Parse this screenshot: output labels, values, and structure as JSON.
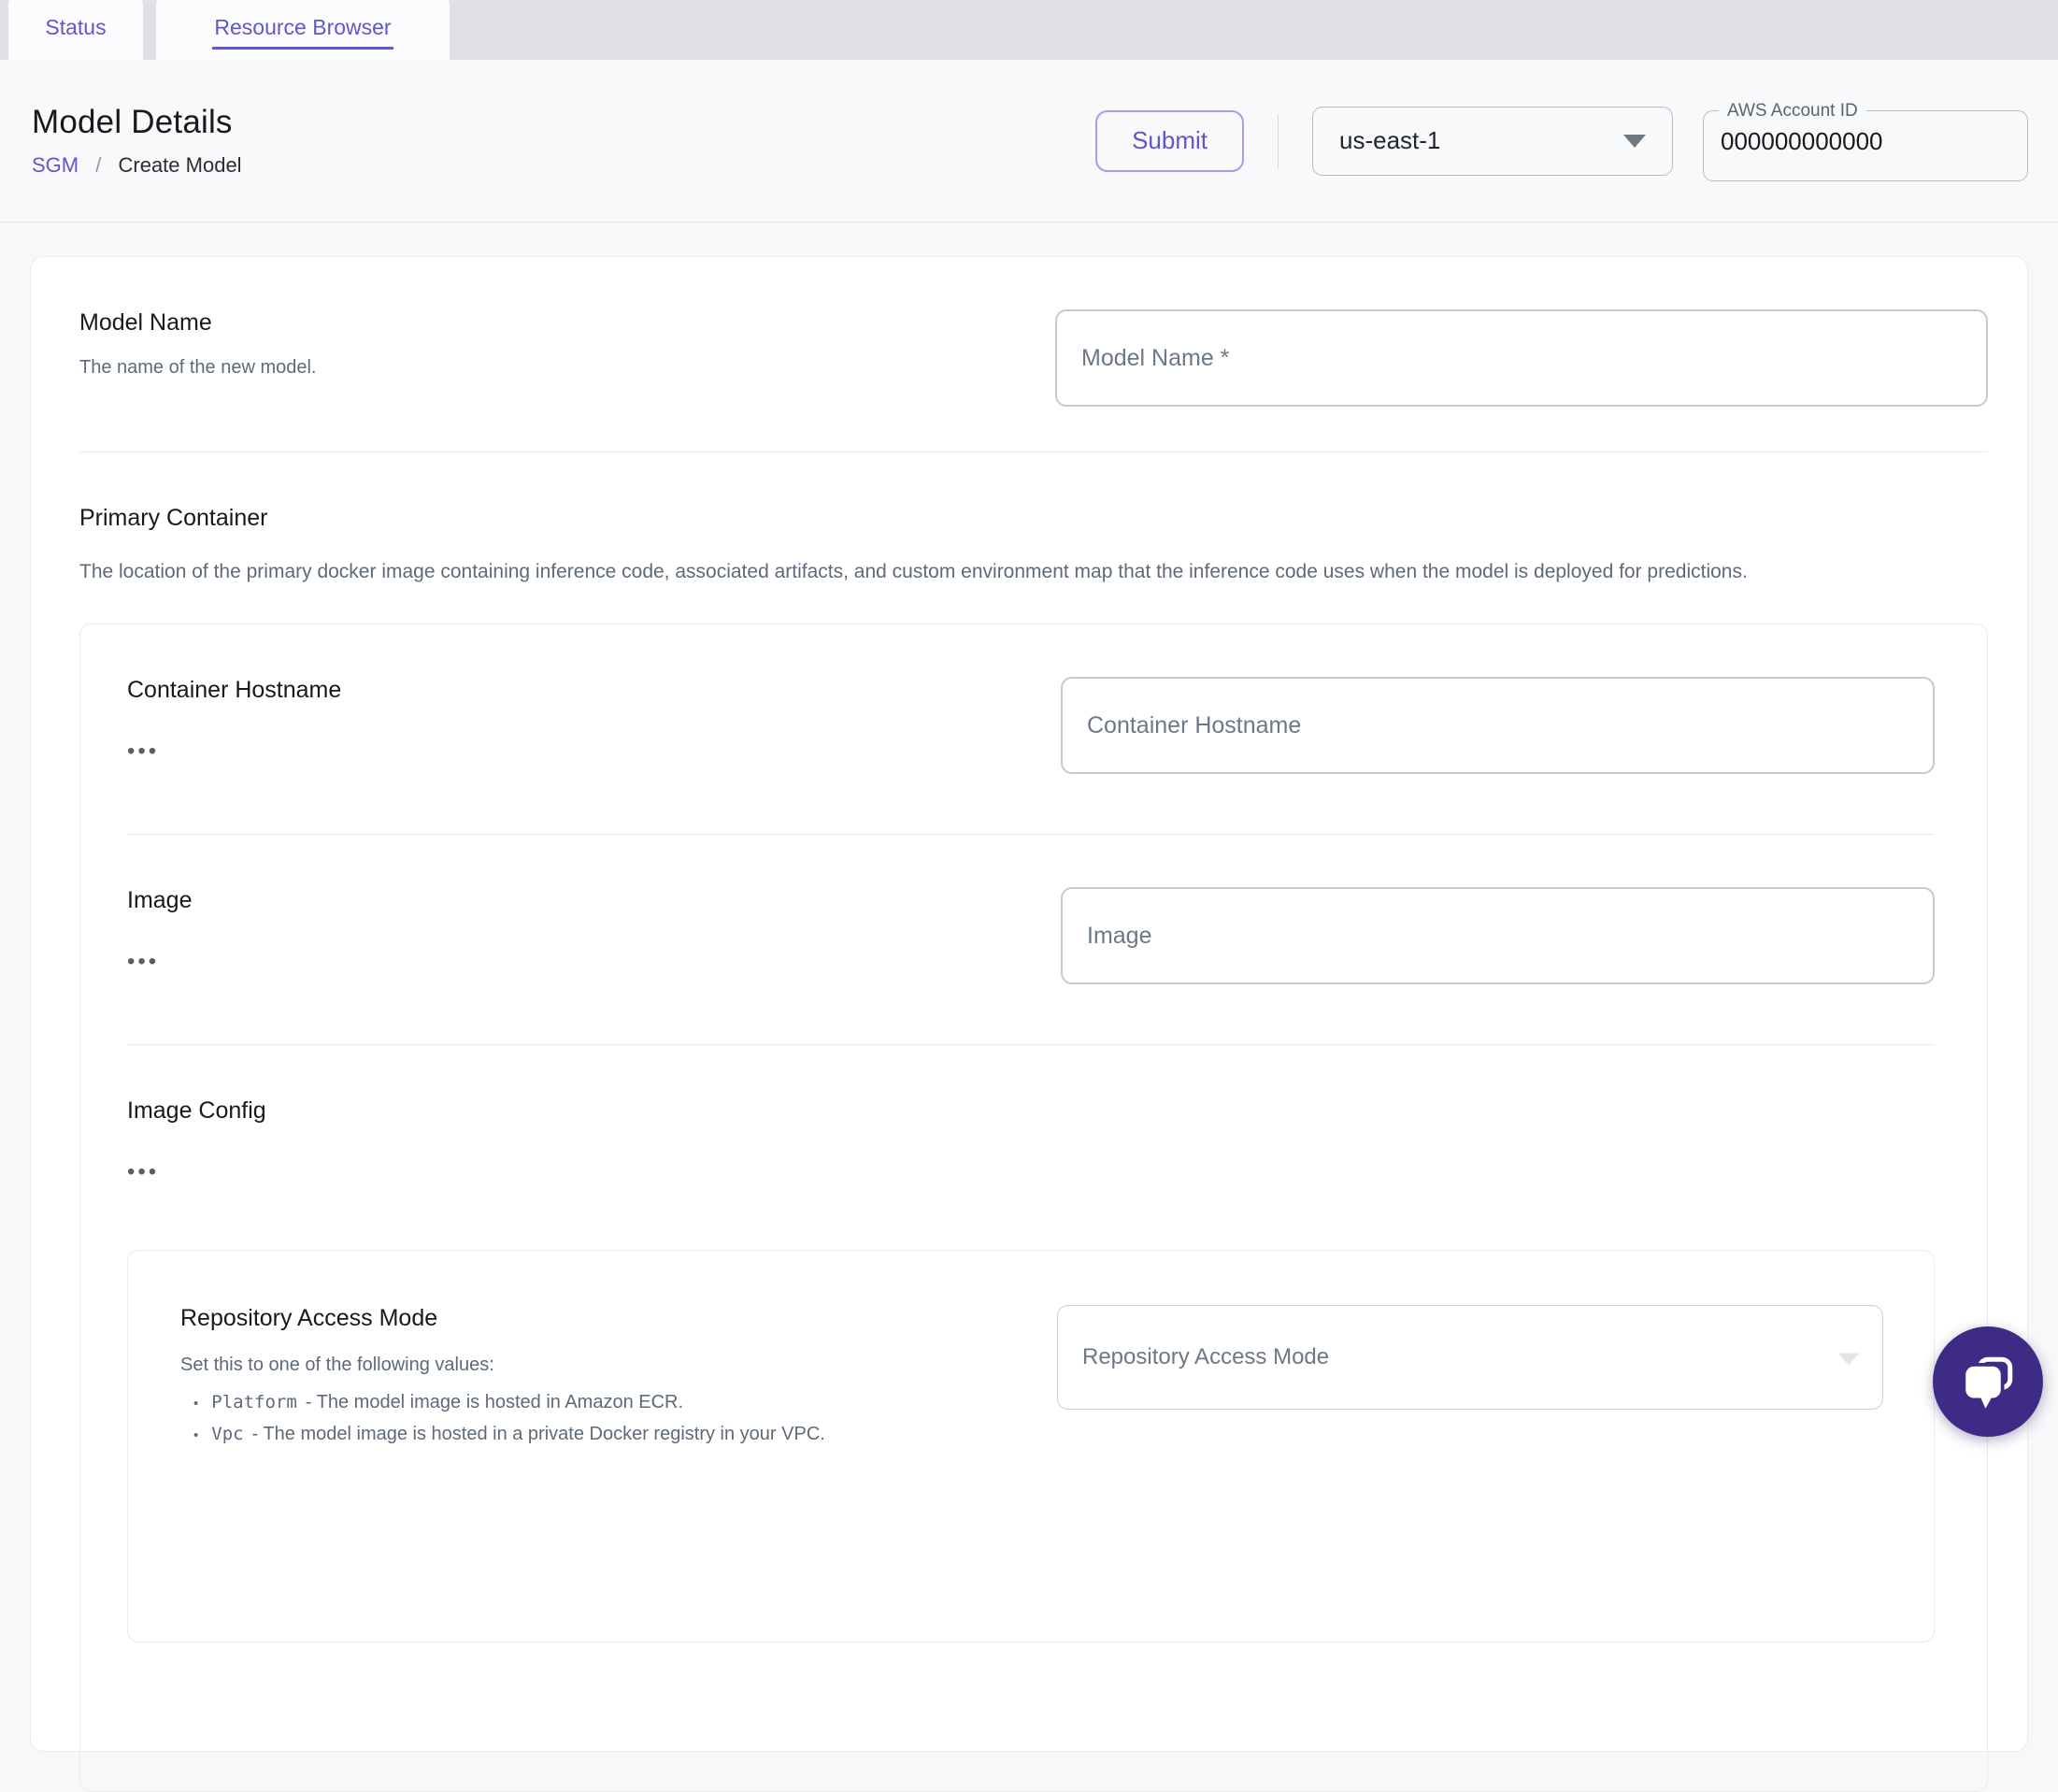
{
  "tab_bar": {
    "tabs": [
      {
        "label": "Status",
        "active": false
      },
      {
        "label": "Resource Browser",
        "active": true
      }
    ]
  },
  "header": {
    "title": "Model Details",
    "breadcrumb": {
      "parent": "SGM",
      "separator": "/",
      "current": "Create Model"
    },
    "submit_label": "Submit",
    "region": {
      "value": "us-east-1"
    },
    "account": {
      "label": "AWS Account ID",
      "value": "000000000000"
    }
  },
  "form": {
    "model_name": {
      "label": "Model Name",
      "description": "The name of the new model.",
      "placeholder": "Model Name *"
    },
    "primary_container": {
      "label": "Primary Container",
      "description": "The location of the primary docker image containing inference code, associated artifacts, and custom environment map that the inference code uses when the model is deployed for predictions.",
      "expander_glyph": "•••",
      "container_hostname": {
        "label": "Container Hostname",
        "placeholder": "Container Hostname"
      },
      "image": {
        "label": "Image",
        "placeholder": "Image"
      },
      "image_config": {
        "label": "Image Config",
        "repository_access_mode": {
          "label": "Repository Access Mode",
          "intro": "Set this to one of the following values:",
          "bullet_glyph": "•",
          "options_help": [
            {
              "code": "Platform",
              "desc": "- The model image is hosted in Amazon ECR."
            },
            {
              "code": "Vpc",
              "desc": "- The model image is hosted in a private Docker registry in your VPC."
            }
          ],
          "placeholder": "Repository Access Mode"
        }
      }
    }
  },
  "colors": {
    "accent_purple": "#6355cb",
    "tab_bar_gray": "#dfe1e5",
    "chat_widget_purple": "#3e2b85"
  }
}
